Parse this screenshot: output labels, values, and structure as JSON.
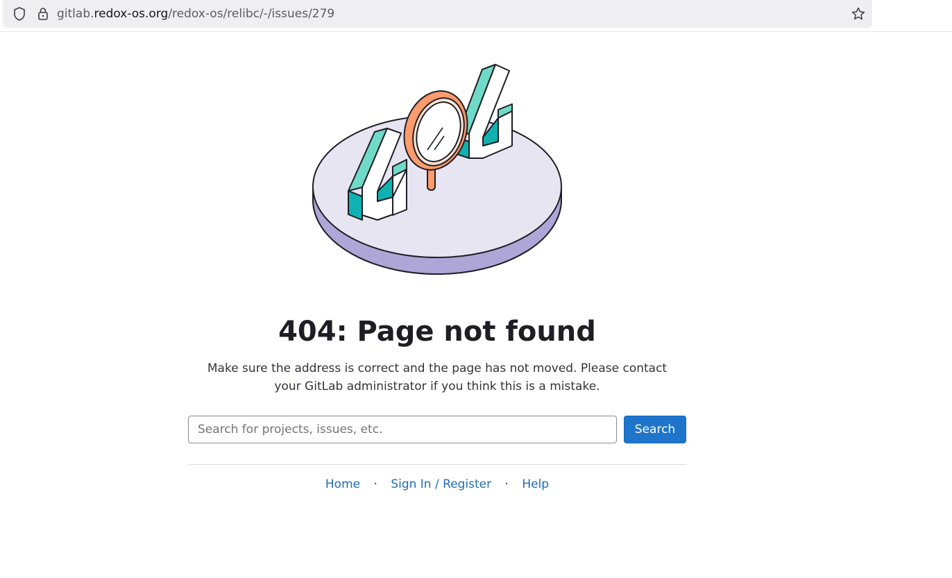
{
  "browser": {
    "url_prefix": "gitlab.",
    "url_host": "redox-os.org",
    "url_path": "/redox-os/relibc/-/issues/279"
  },
  "illustration": {
    "icon": "404-magnifier-illustration",
    "colors": {
      "platform_top": "#e7e5f2",
      "platform_side": "#ada6d6",
      "teal": "#6fdac8",
      "teal_dark": "#10b1b1",
      "orange": "#fc9b6c"
    }
  },
  "error": {
    "title": "404: Page not found",
    "description": "Make sure the address is correct and the page has not moved. Please contact your GitLab administrator if you think this is a mistake."
  },
  "search": {
    "placeholder": "Search for projects, issues, etc.",
    "button_label": "Search"
  },
  "footer": {
    "links": [
      {
        "label": "Home"
      },
      {
        "label": "Sign In / Register"
      },
      {
        "label": "Help"
      }
    ],
    "separator": "·"
  },
  "colors": {
    "primary": "#1f75cb",
    "link": "#1f6cb5"
  }
}
